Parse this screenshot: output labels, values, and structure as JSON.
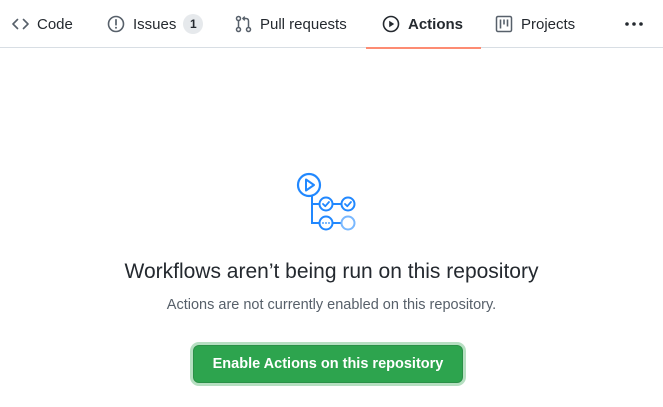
{
  "tabs": [
    {
      "label": "Code",
      "icon": "code-icon"
    },
    {
      "label": "Issues",
      "icon": "issue-opened-icon",
      "count": "1"
    },
    {
      "label": "Pull requests",
      "icon": "git-pull-request-icon"
    },
    {
      "label": "Actions",
      "icon": "play-icon",
      "active": true
    },
    {
      "label": "Projects",
      "icon": "project-icon"
    }
  ],
  "more_icon": "kebab-horizontal-icon",
  "blankslate": {
    "illustration": "workflow-graph-icon",
    "headline": "Workflows aren’t being run on this repository",
    "description": "Actions are not currently enabled on this repository.",
    "button_label": "Enable Actions on this repository"
  },
  "colors": {
    "accent_underline": "#fd8c73",
    "primary_button": "#2da44e",
    "illustration_blue": "#2188ff",
    "illustration_light_blue": "#79b8ff"
  }
}
